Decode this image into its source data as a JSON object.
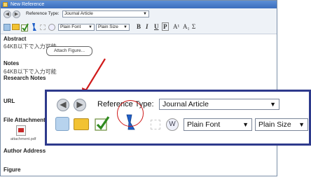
{
  "window": {
    "title": "New Reference"
  },
  "toolbar1": {
    "back_arrow": "◀",
    "forward_arrow": "▶",
    "reference_type_label": "Reference Type:",
    "reference_type_value": "Journal Article"
  },
  "toolbar2": {
    "font_value": "Plain Font",
    "size_value": "Plain Size",
    "bold": "B",
    "italic": "I",
    "underline": "U",
    "plain": "P",
    "superscript": "A¹",
    "subscript": "A₁",
    "symbol": "Σ",
    "tooltip": "Attach Figure..."
  },
  "fields": [
    {
      "label": "Abstract",
      "value": "64KB以下で入力可能"
    },
    {
      "label": "Notes",
      "value": "64KB以下で入力可能"
    },
    {
      "label": "Research Notes",
      "value": ""
    },
    {
      "label": "URL",
      "value": ""
    },
    {
      "label": "File Attachments",
      "value": ""
    },
    {
      "label": "Author Address",
      "value": ""
    },
    {
      "label": "Figure",
      "value": ""
    }
  ],
  "attachment": {
    "filename": "attachment.pdf"
  },
  "zoom": {
    "back_arrow": "◀",
    "forward_arrow": "▶",
    "reference_type_label": "Reference Type:",
    "reference_type_value": "Journal Article",
    "font_value": "Plain Font",
    "size_value": "Plain Size"
  },
  "colors": {
    "annotation": "#d01a1a",
    "zoom_border": "#2e3a8c"
  }
}
